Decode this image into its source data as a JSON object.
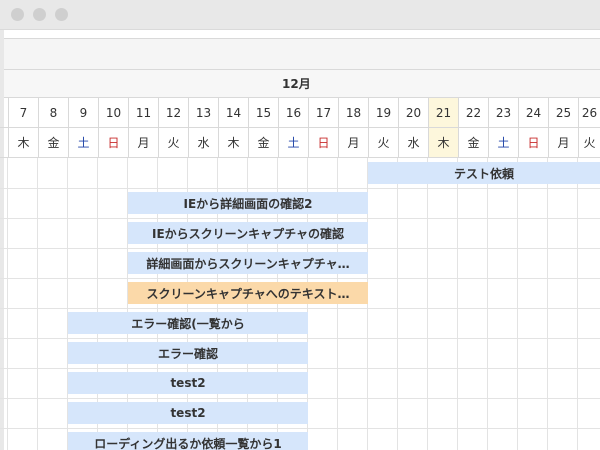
{
  "calendar": {
    "month": "12月",
    "days": [
      {
        "date": "7",
        "weekday": "木",
        "kind": "normal"
      },
      {
        "date": "8",
        "weekday": "金",
        "kind": "normal"
      },
      {
        "date": "9",
        "weekday": "土",
        "kind": "sat"
      },
      {
        "date": "10",
        "weekday": "日",
        "kind": "sun"
      },
      {
        "date": "11",
        "weekday": "月",
        "kind": "normal"
      },
      {
        "date": "12",
        "weekday": "火",
        "kind": "normal"
      },
      {
        "date": "13",
        "weekday": "水",
        "kind": "normal"
      },
      {
        "date": "14",
        "weekday": "木",
        "kind": "normal"
      },
      {
        "date": "15",
        "weekday": "金",
        "kind": "normal"
      },
      {
        "date": "16",
        "weekday": "土",
        "kind": "sat"
      },
      {
        "date": "17",
        "weekday": "日",
        "kind": "sun"
      },
      {
        "date": "18",
        "weekday": "月",
        "kind": "normal"
      },
      {
        "date": "19",
        "weekday": "火",
        "kind": "normal"
      },
      {
        "date": "20",
        "weekday": "水",
        "kind": "normal"
      },
      {
        "date": "21",
        "weekday": "木",
        "kind": "today"
      },
      {
        "date": "22",
        "weekday": "金",
        "kind": "normal"
      },
      {
        "date": "23",
        "weekday": "土",
        "kind": "sat"
      },
      {
        "date": "24",
        "weekday": "日",
        "kind": "sun"
      },
      {
        "date": "25",
        "weekday": "月",
        "kind": "normal"
      },
      {
        "date": "26",
        "weekday": "火",
        "kind": "normal"
      }
    ],
    "colors": {
      "bar": "#d6e6fb",
      "bar_highlight": "#fbd9a9",
      "today": "#fdf7dc",
      "saturday": "#2346a8",
      "sunday": "#c72b2b"
    }
  },
  "tasks": [
    {
      "label": "テスト依頼",
      "start": 12,
      "end": 19,
      "highlight": false
    },
    {
      "label": "IEから詳細画面の確認2",
      "start": 4,
      "end": 11,
      "highlight": false
    },
    {
      "label": "IEからスクリーンキャプチャの確認",
      "start": 4,
      "end": 11,
      "highlight": false
    },
    {
      "label": "詳細画面からスクリーンキャプチャ…",
      "start": 4,
      "end": 11,
      "highlight": false
    },
    {
      "label": "スクリーンキャプチャへのテキスト…",
      "start": 4,
      "end": 11,
      "highlight": true
    },
    {
      "label": "エラー確認(一覧から",
      "start": 2,
      "end": 9,
      "highlight": false
    },
    {
      "label": "エラー確認",
      "start": 2,
      "end": 9,
      "highlight": false
    },
    {
      "label": "test2",
      "start": 2,
      "end": 9,
      "highlight": false
    },
    {
      "label": "test2",
      "start": 2,
      "end": 9,
      "highlight": false
    },
    {
      "label": "ローディング出るか依頼一覧から1",
      "start": 2,
      "end": 9,
      "highlight": false
    }
  ]
}
